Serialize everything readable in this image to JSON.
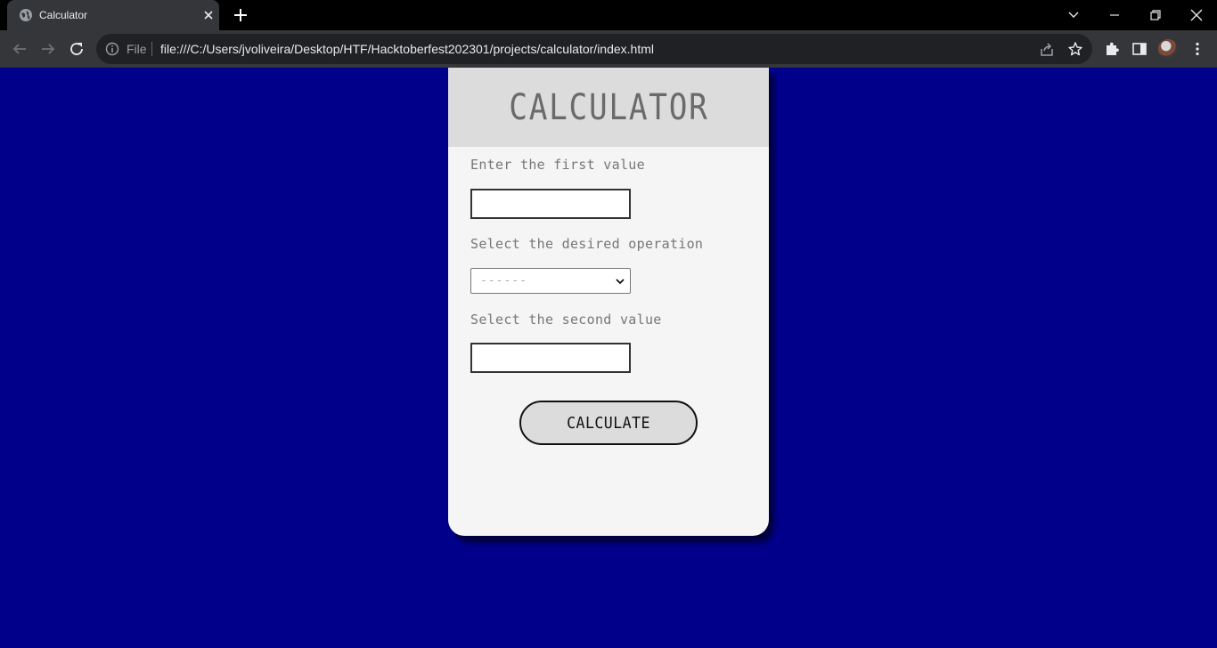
{
  "browser": {
    "tab": {
      "title": "Calculator"
    },
    "address_bar": {
      "scheme_label": "File",
      "url": "file:///C:/Users/jvoliveira/Desktop/HTF/Hacktoberfest202301/projects/calculator/index.html"
    }
  },
  "calculator": {
    "title": "CALCULATOR",
    "first_value_label": "Enter the first value",
    "first_value": "",
    "operation_label": "Select the desired operation",
    "operation_selected": "------",
    "second_value_label": "Select the second value",
    "second_value": "",
    "calculate_label": "CALCULATE"
  },
  "colors": {
    "page_background": "#00008b",
    "card_background": "#f5f5f5",
    "header_background": "#dcdcdc",
    "browser_frame": "#35363a"
  }
}
